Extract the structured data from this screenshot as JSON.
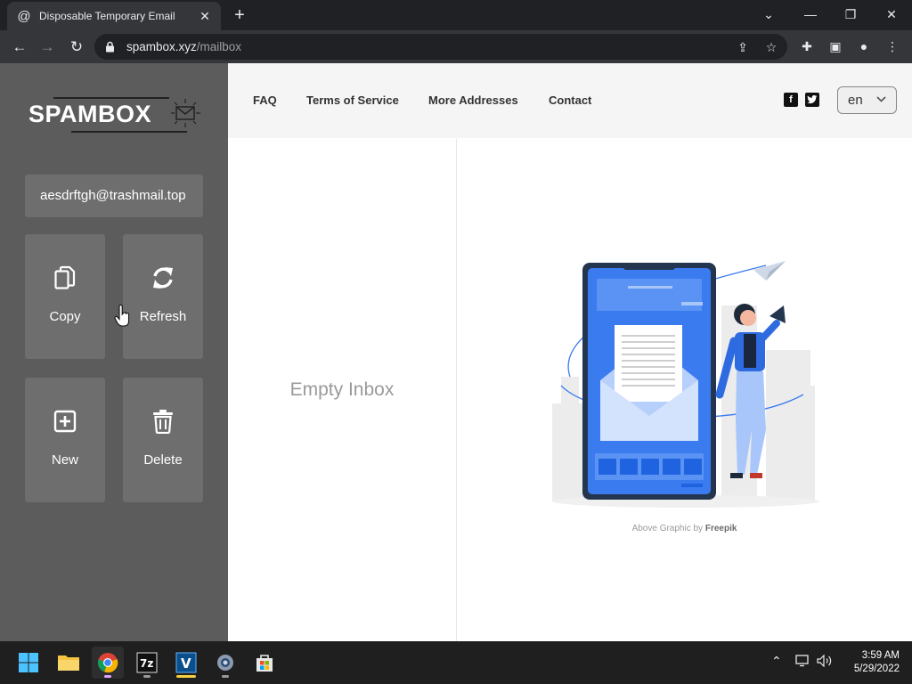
{
  "browser": {
    "tab_title": "Disposable Temporary Email",
    "tab_favicon": "@",
    "url_host": "spambox.xyz",
    "url_path": "/mailbox"
  },
  "sidebar": {
    "logo_text": "SPAMBOX",
    "email_address": "aesdrftgh@trashmail.top",
    "actions": [
      {
        "label": "Copy",
        "icon": "copy-icon"
      },
      {
        "label": "Refresh",
        "icon": "refresh-icon"
      },
      {
        "label": "New",
        "icon": "plus-square-icon"
      },
      {
        "label": "Delete",
        "icon": "trash-icon"
      }
    ]
  },
  "header": {
    "nav": [
      "FAQ",
      "Terms of Service",
      "More Addresses",
      "Contact"
    ],
    "social": [
      "facebook-icon",
      "twitter-icon"
    ],
    "language": "en"
  },
  "main": {
    "empty_text": "Empty Inbox",
    "credit_prefix": "Above Graphic by",
    "credit_name": "Freepik"
  },
  "taskbar": {
    "time": "3:59 AM",
    "date": "5/29/2022"
  },
  "colors": {
    "sidebar_bg": "#5c5c5c",
    "button_bg": "#6e6e6e",
    "accent_blue": "#3a7bf0"
  }
}
